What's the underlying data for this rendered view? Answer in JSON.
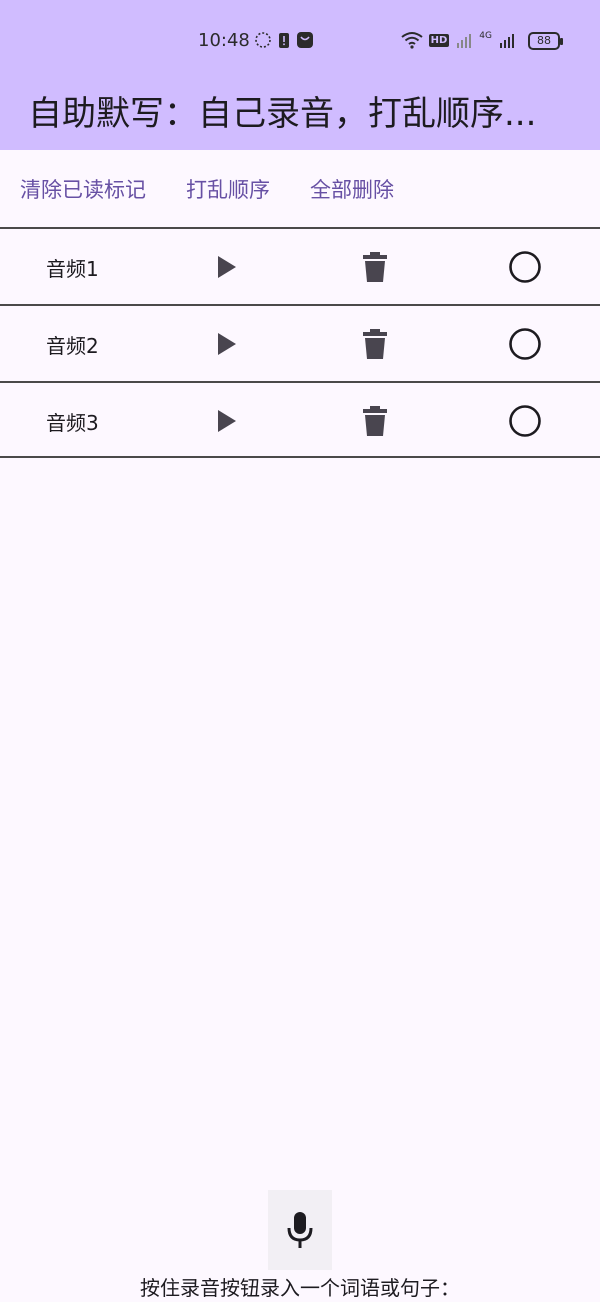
{
  "status_bar": {
    "time": "10:48",
    "battery": "88",
    "network_label": "4G",
    "hd_label": "HD"
  },
  "app_bar": {
    "title": "自助默写：自己录音，打乱顺序..."
  },
  "toolbar": {
    "clear_read_label": "清除已读标记",
    "shuffle_label": "打乱顺序",
    "delete_all_label": "全部删除"
  },
  "recordings": [
    {
      "label": "音频1"
    },
    {
      "label": "音频2"
    },
    {
      "label": "音频3"
    }
  ],
  "footer": {
    "hint": "按住录音按钮录入一个词语或句子："
  },
  "colors": {
    "accent": "#6750a4",
    "app_bar": "#d0bcff",
    "background": "#fdf8ff"
  }
}
